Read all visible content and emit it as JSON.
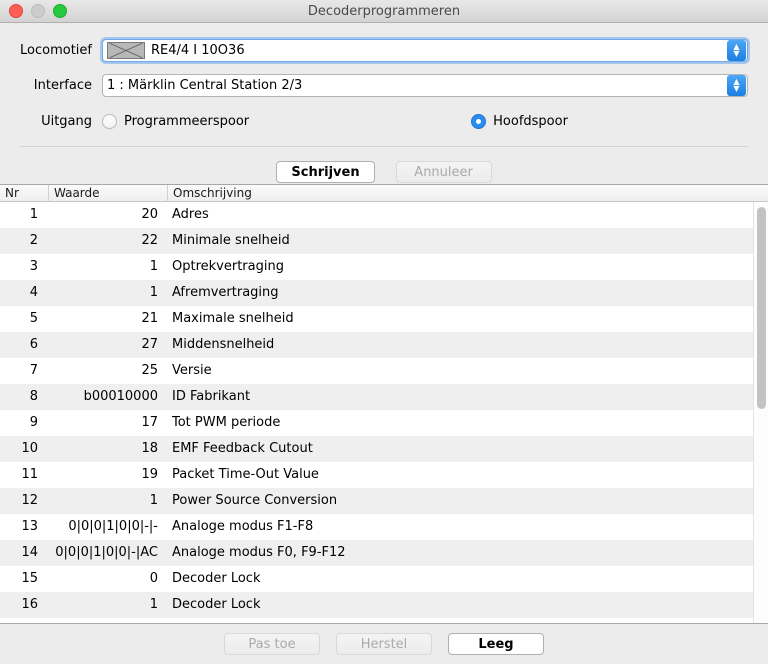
{
  "window": {
    "title": "Decoderprogrammeren",
    "traffic_lights": [
      "close-button",
      "minimize-button",
      "zoom-button"
    ]
  },
  "form": {
    "locomotive": {
      "label": "Locomotief",
      "value": "RE4/4 I 10O36",
      "thumbnail_icon": "broken-image-icon",
      "stepper_icon": "up-down-stepper-icon"
    },
    "interface": {
      "label": "Interface",
      "value": "1 : Märklin Central Station 2/3",
      "stepper_icon": "up-down-stepper-icon"
    },
    "output": {
      "label": "Uitgang",
      "options": [
        {
          "label": "Programmeerspoor",
          "selected": false
        },
        {
          "label": "Hoofdspoor",
          "selected": true
        }
      ]
    }
  },
  "actions": {
    "write": {
      "label": "Schrijven",
      "enabled": true,
      "default": true
    },
    "cancel": {
      "label": "Annuleer",
      "enabled": false
    }
  },
  "table": {
    "columns": [
      "Nr",
      "Waarde",
      "Omschrijving"
    ],
    "rows": [
      {
        "nr": "1",
        "waarde": "20",
        "omschrijving": "Adres"
      },
      {
        "nr": "2",
        "waarde": "22",
        "omschrijving": "Minimale snelheid"
      },
      {
        "nr": "3",
        "waarde": "1",
        "omschrijving": "Optrekvertraging"
      },
      {
        "nr": "4",
        "waarde": "1",
        "omschrijving": "Afremvertraging"
      },
      {
        "nr": "5",
        "waarde": "21",
        "omschrijving": "Maximale snelheid"
      },
      {
        "nr": "6",
        "waarde": "27",
        "omschrijving": "Middensnelheid"
      },
      {
        "nr": "7",
        "waarde": "25",
        "omschrijving": "Versie"
      },
      {
        "nr": "8",
        "waarde": "b00010000",
        "omschrijving": "ID Fabrikant"
      },
      {
        "nr": "9",
        "waarde": "17",
        "omschrijving": "Tot PWM periode"
      },
      {
        "nr": "10",
        "waarde": "18",
        "omschrijving": "EMF Feedback Cutout"
      },
      {
        "nr": "11",
        "waarde": "19",
        "omschrijving": "Packet Time-Out Value"
      },
      {
        "nr": "12",
        "waarde": "1",
        "omschrijving": "Power Source Conversion"
      },
      {
        "nr": "13",
        "waarde": "0|0|0|1|0|0|-|-",
        "omschrijving": "Analoge modus F1-F8"
      },
      {
        "nr": "14",
        "waarde": "0|0|0|1|0|0|-|AC",
        "omschrijving": "Analoge modus F0, F9-F12"
      },
      {
        "nr": "15",
        "waarde": "0",
        "omschrijving": "Decoder Lock"
      },
      {
        "nr": "16",
        "waarde": "1",
        "omschrijving": "Decoder Lock"
      }
    ],
    "scrollbar": "vertical-scrollbar"
  },
  "footer": {
    "apply": {
      "label": "Pas toe",
      "enabled": false
    },
    "reset": {
      "label": "Herstel",
      "enabled": false
    },
    "clear": {
      "label": "Leeg",
      "enabled": true
    }
  },
  "colors": {
    "accent": "#2b8cf0",
    "window_bg": "#ececec",
    "row_alt": "#efefef"
  }
}
